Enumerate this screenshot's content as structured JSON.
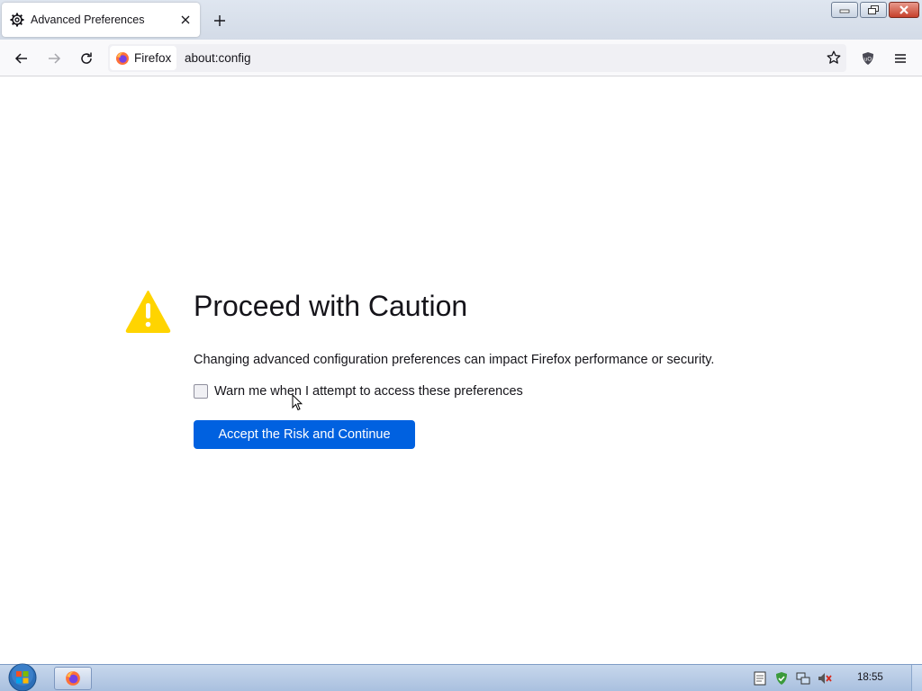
{
  "window": {
    "tab_title": "Advanced Preferences",
    "tab_icon": "gear-icon",
    "controls": [
      "minimize-icon",
      "restore-icon",
      "close-icon"
    ]
  },
  "navbar": {
    "identity_label": "Firefox",
    "url": "about:config",
    "icons": [
      "back-icon",
      "forward-icon",
      "reload-icon",
      "bookmark-star-icon",
      "ublock-shield-icon",
      "hamburger-menu-icon"
    ]
  },
  "page": {
    "heading": "Proceed with Caution",
    "description": "Changing advanced configuration preferences can impact Firefox performance or security.",
    "checkbox_label": "Warn me when I attempt to access these preferences",
    "checkbox_checked": false,
    "accept_button": "Accept the Risk and Continue",
    "accent_color": "#0061e0",
    "warning_color": "#ffd400"
  },
  "taskbar": {
    "clock": "18:55",
    "tasks": [
      "firefox-icon"
    ],
    "tray_icons": [
      "notepad-icon",
      "security-icon",
      "network-icon",
      "volume-muted-icon"
    ]
  }
}
